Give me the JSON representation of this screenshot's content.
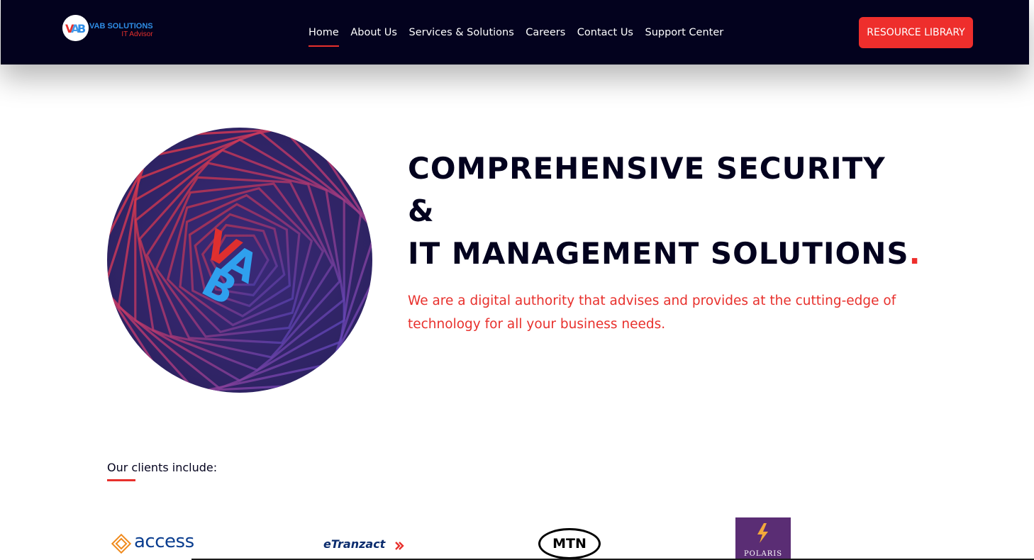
{
  "header": {
    "logo": {
      "name": "VAB SOLUTIONS",
      "tagline": "IT Advisor",
      "badge_text": "VAB"
    },
    "nav": [
      {
        "label": "Home",
        "active": true
      },
      {
        "label": "About Us",
        "active": false
      },
      {
        "label": "Services & Solutions",
        "active": false
      },
      {
        "label": "Careers",
        "active": false
      },
      {
        "label": "Contact Us",
        "active": false
      },
      {
        "label": "Support Center",
        "active": false
      }
    ],
    "cta_label": "RESOURCE LIBRARY"
  },
  "hero": {
    "graphic_text": "VAB",
    "title_lines": [
      "COMPREHENSIVE SECURITY",
      "&",
      "IT MANAGEMENT SOLUTIONS"
    ],
    "title_dot": ".",
    "subtitle": "We are a digital authority that advises and provides at the cutting-edge of technology for all your business needs."
  },
  "clients": {
    "label": "Our clients include:",
    "logos": [
      {
        "name": "access"
      },
      {
        "name": "eTranzact"
      },
      {
        "name": "MTN"
      },
      {
        "name": "POLARIS"
      }
    ]
  },
  "colors": {
    "navy": "#03021e",
    "accent_red": "#ee2e2c",
    "brand_blue": "#2f8ee6"
  }
}
